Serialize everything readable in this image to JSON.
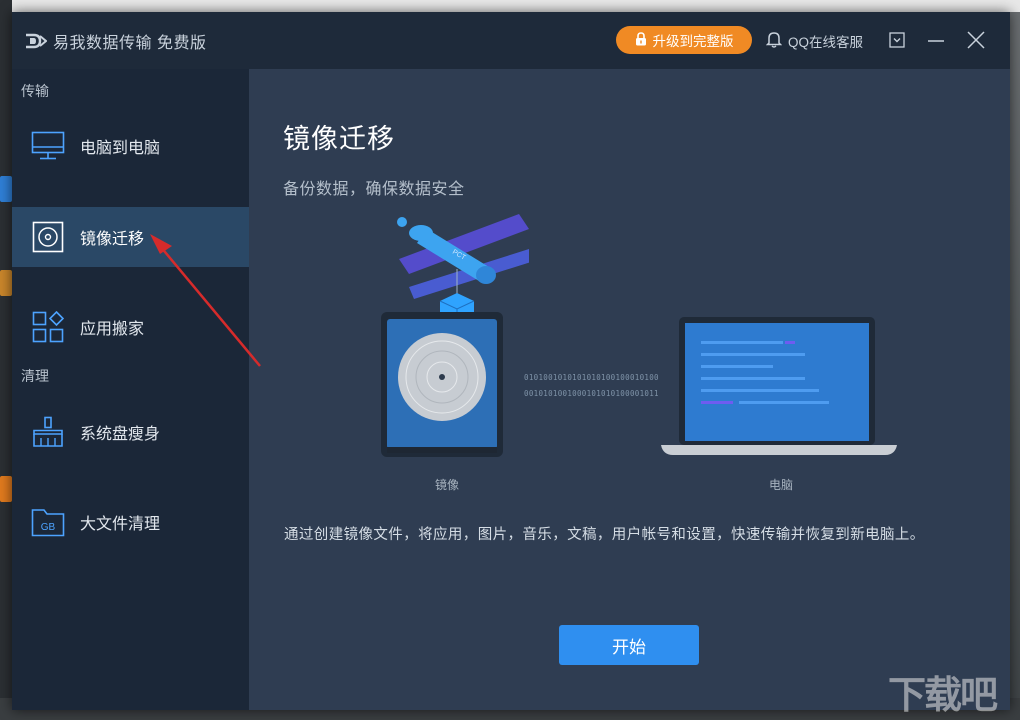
{
  "app": {
    "title": "易我数据传输 免费版",
    "upgrade_label": "升级到完整版",
    "support_label": "QQ在线客服"
  },
  "sidebar": {
    "sections": [
      {
        "label": "传输"
      },
      {
        "label": "清理"
      }
    ],
    "items": [
      {
        "label": "电脑到电脑",
        "icon": "monitor-icon"
      },
      {
        "label": "镜像迁移",
        "icon": "disc-icon",
        "active": true
      },
      {
        "label": "应用搬家",
        "icon": "apps-grid-icon"
      },
      {
        "label": "系统盘瘦身",
        "icon": "broom-icon"
      },
      {
        "label": "大文件清理",
        "icon": "gb-folder-icon"
      }
    ]
  },
  "main": {
    "title": "镜像迁移",
    "subtitle": "备份数据，确保数据安全",
    "illustration": {
      "left_label": "镜像",
      "right_label": "电脑",
      "binary_line1": "0101001010101010100100010100",
      "binary_line2": "0010101001000101010100001011",
      "satellite_text": "PCT"
    },
    "description": "通过创建镜像文件，将应用，图片，音乐，文稿，用户帐号和设置，快速传输并恢复到新电脑上。",
    "start_label": "开始"
  },
  "watermark": "下载吧",
  "colors": {
    "accent_orange": "#f08a24",
    "accent_blue": "#2f8ff0",
    "sidebar_bg": "#1b2738",
    "sidebar_active": "#2a4866",
    "main_bg": "#2f3d52",
    "annotation_arrow": "#d62b2b"
  }
}
